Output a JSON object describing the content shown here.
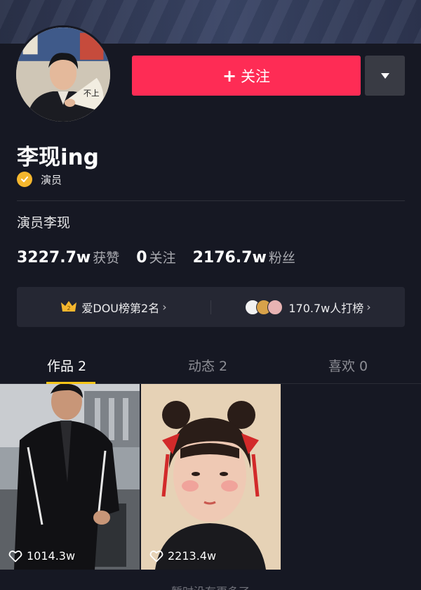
{
  "profile": {
    "name": "李现ing",
    "badge": "演员",
    "bio": "演员李现",
    "follow_label": "关注",
    "follow_prefix": "+"
  },
  "stats": [
    {
      "num": "3227.7w",
      "label": "获赞"
    },
    {
      "num": "0",
      "label": "关注"
    },
    {
      "num": "2176.7w",
      "label": "粉丝"
    }
  ],
  "rank": {
    "left_text": "爱DOU榜第2名",
    "right_text": "170.7w人打榜",
    "chevron": "›",
    "crown_number": "2"
  },
  "tabs": [
    {
      "label": "作品 2",
      "active": true
    },
    {
      "label": "动态 2",
      "active": false
    },
    {
      "label": "喜欢 0",
      "active": false
    }
  ],
  "videos": [
    {
      "likes": "1014.3w"
    },
    {
      "likes": "2213.4w"
    }
  ],
  "footer": {
    "text": "暂时没有更多了"
  },
  "colors": {
    "background": "#161823",
    "accent_pink": "#fe2c55",
    "badge_gold": "#f5b72e",
    "tab_indicator": "#f5c518"
  },
  "icons": [
    "verified-icon",
    "caret-down-icon",
    "crown-icon",
    "heart-icon",
    "chevron-right-icon"
  ]
}
